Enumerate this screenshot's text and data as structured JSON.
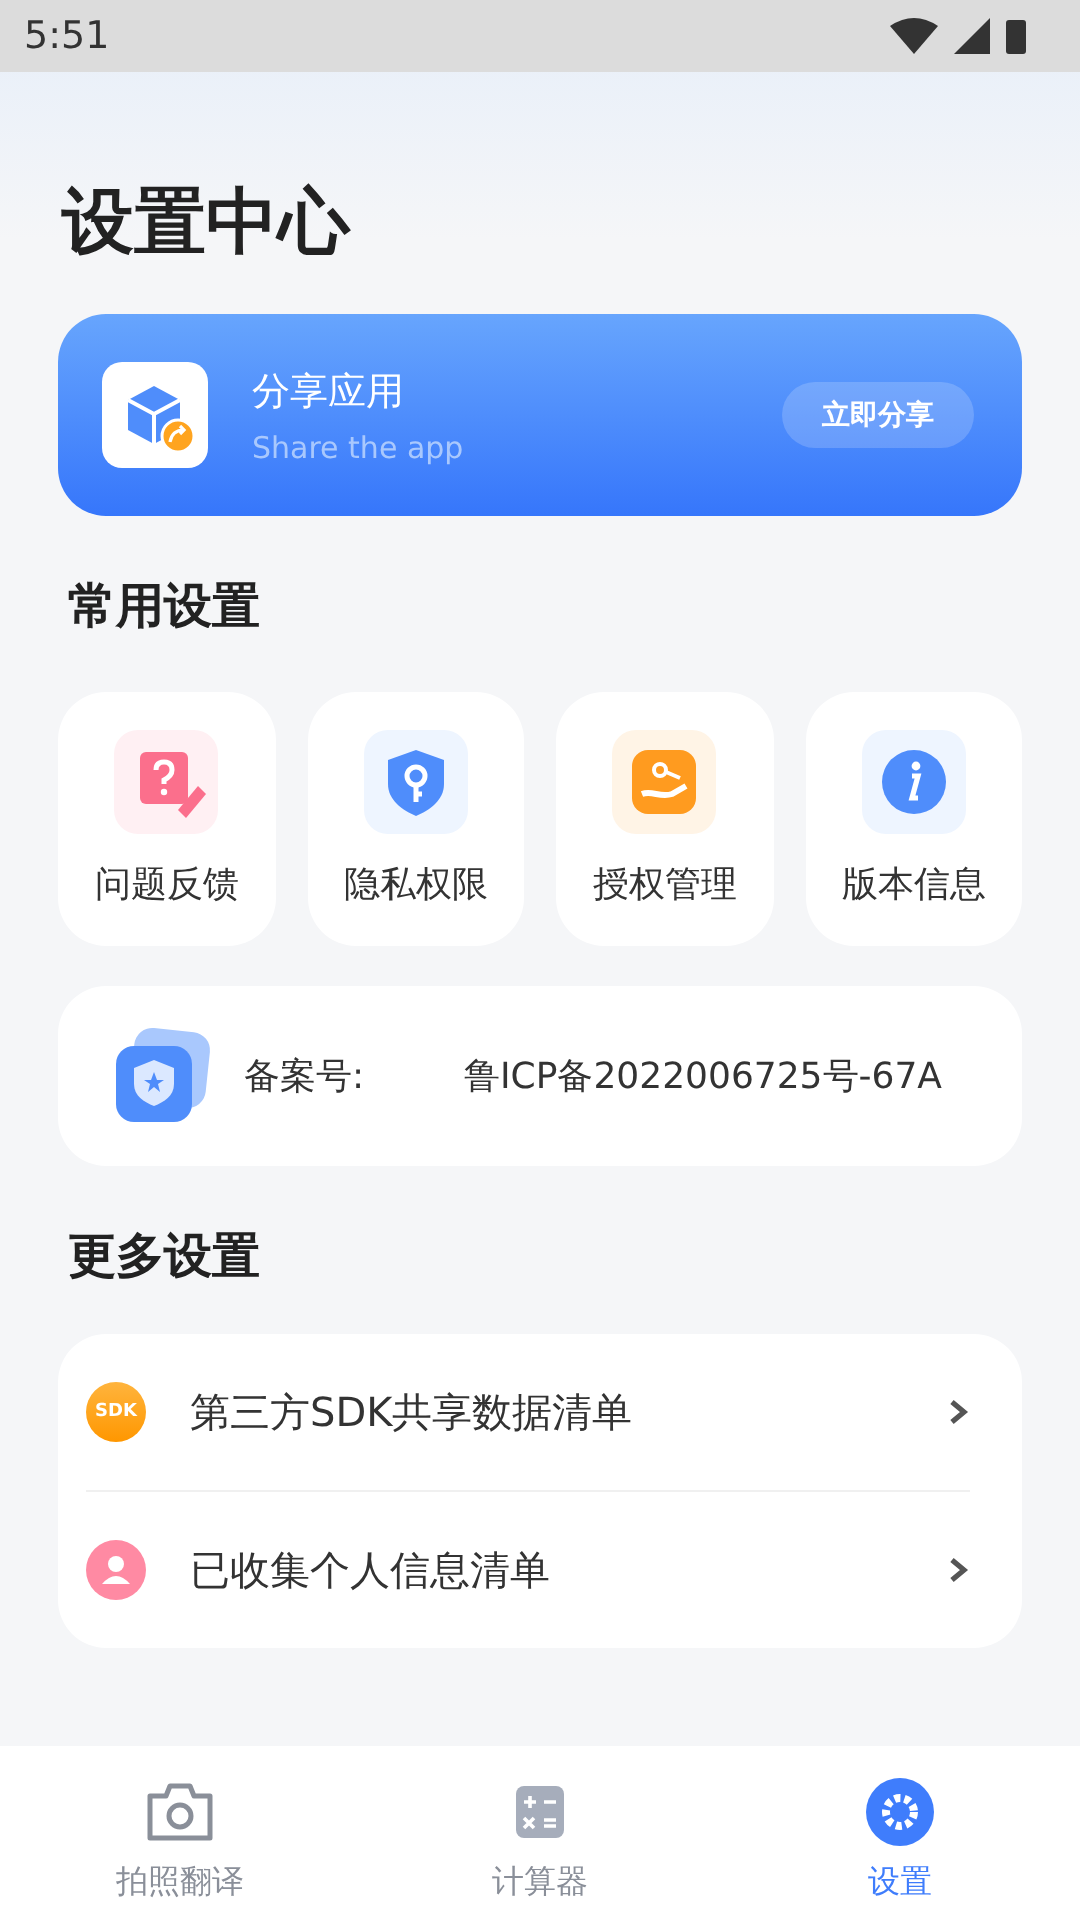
{
  "status_bar": {
    "time": "5:51"
  },
  "title": "设置中心",
  "share_card": {
    "title": "分享应用",
    "subtitle": "Share the app",
    "button": "立即分享"
  },
  "common_section": {
    "title": "常用设置",
    "items": [
      {
        "label": "问题反馈",
        "kind": "feedback"
      },
      {
        "label": "隐私权限",
        "kind": "privacy"
      },
      {
        "label": "授权管理",
        "kind": "auth"
      },
      {
        "label": "版本信息",
        "kind": "info"
      }
    ]
  },
  "record": {
    "label": "备案号:",
    "value": "鲁ICP备2022006725号-67A"
  },
  "more_section": {
    "title": "更多设置",
    "items": [
      {
        "label": "第三方SDK共享数据清单",
        "kind": "sdk",
        "badge": "SDK"
      },
      {
        "label": "已收集个人信息清单",
        "kind": "person"
      }
    ]
  },
  "tabs": [
    {
      "label": "拍照翻译",
      "kind": "camera",
      "selected": false
    },
    {
      "label": "计算器",
      "kind": "calculator",
      "selected": false
    },
    {
      "label": "设置",
      "kind": "settings",
      "selected": true
    }
  ]
}
